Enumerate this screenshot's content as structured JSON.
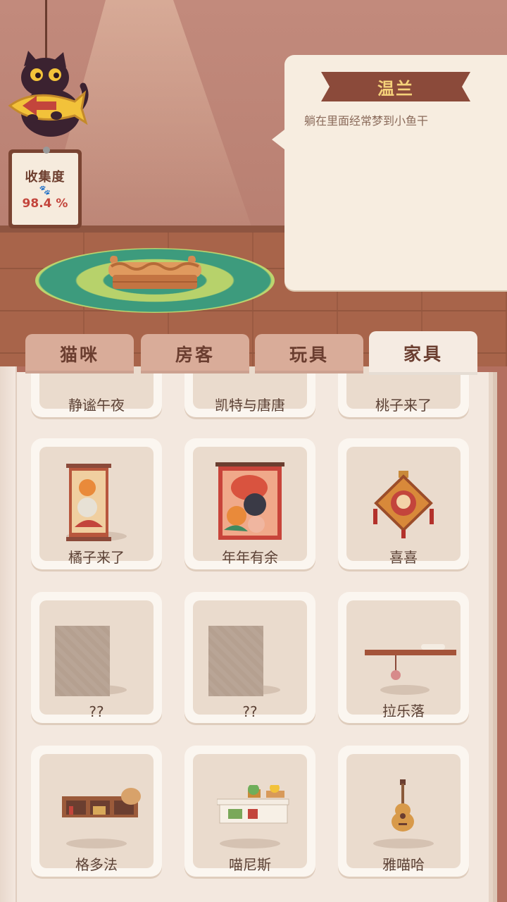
{
  "collection": {
    "title": "收集度",
    "value": "98.4 %"
  },
  "selected_item": {
    "name": "温兰",
    "description": "躺在里面经常梦到小鱼干"
  },
  "tabs": [
    {
      "label": "猫咪",
      "active": false
    },
    {
      "label": "房客",
      "active": false
    },
    {
      "label": "玩具",
      "active": false
    },
    {
      "label": "家具",
      "active": true
    }
  ],
  "items": [
    {
      "label": "静谧午夜",
      "icon": "partial-card"
    },
    {
      "label": "凯特与唐唐",
      "icon": "partial-card"
    },
    {
      "label": "桃子来了",
      "icon": "partial-card"
    },
    {
      "label": "橘子来了",
      "icon": "orange-cat-scroll-icon"
    },
    {
      "label": "年年有余",
      "icon": "fish-cat-poster-icon"
    },
    {
      "label": "喜喜",
      "icon": "lucky-charm-icon"
    },
    {
      "label": "??",
      "icon": "locked-placeholder"
    },
    {
      "label": "??",
      "icon": "locked-placeholder"
    },
    {
      "label": "拉乐落",
      "icon": "wall-shelf-yarn-icon"
    },
    {
      "label": "格多法",
      "icon": "cubby-shelf-icon"
    },
    {
      "label": "喵尼斯",
      "icon": "white-plant-shelf-icon"
    },
    {
      "label": "雅喵哈",
      "icon": "guitar-icon"
    }
  ],
  "colors": {
    "accent_red": "#c3453c",
    "tab_brown": "#6b3e30",
    "ribbon": "#8b4a3a",
    "name_gold": "#f5d27a"
  }
}
